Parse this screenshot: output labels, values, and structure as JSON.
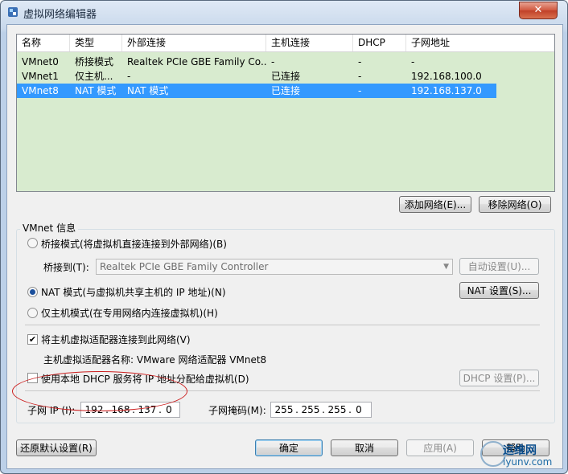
{
  "window": {
    "title": "虚拟网络编辑器",
    "close_glyph": "✕"
  },
  "table": {
    "columns": [
      "名称",
      "类型",
      "外部连接",
      "主机连接",
      "DHCP",
      "子网地址"
    ],
    "rows": [
      {
        "name": "VMnet0",
        "type": "桥接模式",
        "external": "Realtek PCIe GBE Family Co...",
        "host": "-",
        "dhcp": "-",
        "subnet": "-",
        "selected": false
      },
      {
        "name": "VMnet1",
        "type": "仅主机...",
        "external": "-",
        "host": "已连接",
        "dhcp": "-",
        "subnet": "192.168.100.0",
        "selected": false
      },
      {
        "name": "VMnet8",
        "type": "NAT 模式",
        "external": "NAT 模式",
        "host": "已连接",
        "dhcp": "-",
        "subnet": "192.168.137.0",
        "selected": true
      }
    ]
  },
  "buttons": {
    "add_network": "添加网络(E)...",
    "remove_network": "移除网络(O)",
    "auto_settings": "自动设置(U)...",
    "nat_settings": "NAT 设置(S)...",
    "dhcp_settings": "DHCP 设置(P)...",
    "restore_defaults": "还原默认设置(R)",
    "ok": "确定",
    "cancel": "取消",
    "apply": "应用(A)",
    "help": "帮助"
  },
  "vmnet_info": {
    "group_title": "VMnet 信息",
    "bridged_label": "桥接模式(将虚拟机直接连接到外部网络)(B)",
    "bridged_to_label": "桥接到(T):",
    "bridged_to_value": "Realtek PCIe GBE Family Controller",
    "nat_label": "NAT 模式(与虚拟机共享主机的 IP 地址)(N)",
    "hostonly_label": "仅主机模式(在专用网络内连接虚拟机)(H)",
    "selected_mode": "nat",
    "connect_adapter_label": "将主机虚拟适配器连接到此网络(V)",
    "connect_adapter_checked": true,
    "adapter_name_text": "主机虚拟适配器名称: VMware 网络适配器 VMnet8",
    "dhcp_label": "使用本地 DHCP 服务将 IP 地址分配给虚拟机(D)",
    "dhcp_checked": false,
    "subnet_ip_label": "子网 IP (I):",
    "subnet_ip": [
      "192",
      "168",
      "137",
      "0"
    ],
    "subnet_mask_label": "子网掩码(M):",
    "subnet_mask": [
      "255",
      "255",
      "255",
      "0"
    ],
    "ip_dot": "."
  },
  "watermark": {
    "line1": "运维网",
    "line2": "iyunv.com"
  },
  "colors": {
    "list_bg": "#d8ebcf",
    "selection": "#3399ff",
    "annotation": "#cc1f1f"
  }
}
